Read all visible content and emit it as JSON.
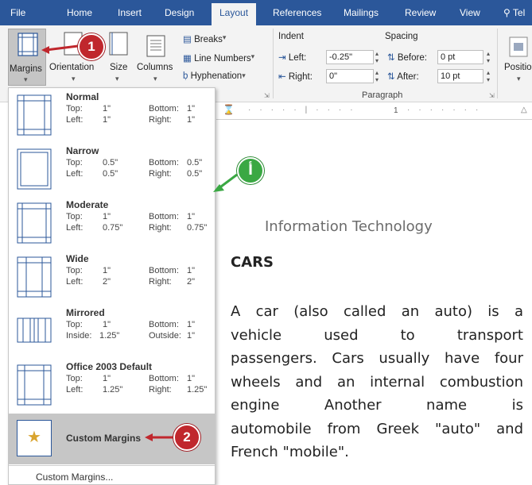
{
  "menubar": {
    "tabs": [
      "File",
      "Home",
      "Insert",
      "Design",
      "Layout",
      "References",
      "Mailings",
      "Review",
      "View",
      "Tel"
    ]
  },
  "ribbon": {
    "margins": "Margins",
    "orientation": "Orientation",
    "size": "Size",
    "columns": "Columns",
    "breaks": "Breaks",
    "line_numbers": "Line Numbers",
    "hyphenation": "Hyphenation",
    "indent_title": "Indent",
    "spacing_title": "Spacing",
    "left_label": "Left:",
    "left_value": "-0.25\"",
    "right_label": "Right:",
    "right_value": "0\"",
    "before_label": "Before:",
    "before_value": "0 pt",
    "after_label": "After:",
    "after_value": "10 pt",
    "paragraph_group": "Paragraph",
    "position": "Positio"
  },
  "margins_menu": {
    "items": [
      {
        "name": "Normal",
        "top_label": "Top:",
        "top": "1\"",
        "bottom_label": "Bottom:",
        "bottom": "1\"",
        "left_label": "Left:",
        "left": "1\"",
        "right_label": "Right:",
        "right": "1\""
      },
      {
        "name": "Narrow",
        "top_label": "Top:",
        "top": "0.5\"",
        "bottom_label": "Bottom:",
        "bottom": "0.5\"",
        "left_label": "Left:",
        "left": "0.5\"",
        "right_label": "Right:",
        "right": "0.5\""
      },
      {
        "name": "Moderate",
        "top_label": "Top:",
        "top": "1\"",
        "bottom_label": "Bottom:",
        "bottom": "1\"",
        "left_label": "Left:",
        "left": "0.75\"",
        "right_label": "Right:",
        "right": "0.75\""
      },
      {
        "name": "Wide",
        "top_label": "Top:",
        "top": "1\"",
        "bottom_label": "Bottom:",
        "bottom": "1\"",
        "left_label": "Left:",
        "left": "2\"",
        "right_label": "Right:",
        "right": "2\""
      },
      {
        "name": "Mirrored",
        "top_label": "Top:",
        "top": "1\"",
        "bottom_label": "Bottom:",
        "bottom": "1\"",
        "left_label": "Inside:",
        "left": "1.25\"",
        "right_label": "Outside:",
        "right": "1\""
      },
      {
        "name": "Office 2003 Default",
        "top_label": "Top:",
        "top": "1\"",
        "bottom_label": "Bottom:",
        "bottom": "1\"",
        "left_label": "Left:",
        "left": "1.25\"",
        "right_label": "Right:",
        "right": "1.25\""
      }
    ],
    "custom_margins": "Custom Margins",
    "custom_margins_link": "Custom Margins..."
  },
  "document": {
    "header": "Information Technology",
    "title": "CARS",
    "lines": [
      "A car (also called an auto) is a",
      "vehicle used to transport",
      "passengers. Cars usually have four",
      "wheels and an internal combustion",
      "engine Another name is",
      "automobile from Greek \"auto\" and",
      "French \"mobile\"."
    ]
  },
  "ruler": {
    "mark": "1"
  },
  "callouts": {
    "one": "1",
    "two": "2",
    "a": "أ"
  },
  "colors": {
    "brand": "#2b579a",
    "callout_red": "#c0272d",
    "callout_green": "#3aa843",
    "selected": "#c6c6c6"
  }
}
